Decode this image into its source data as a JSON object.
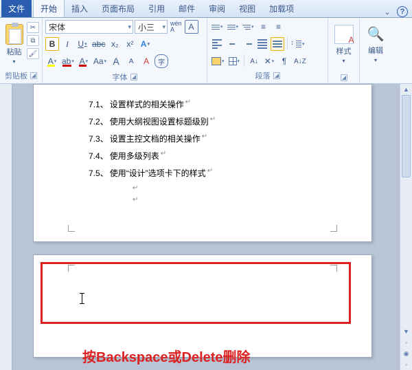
{
  "tabs": {
    "file": "文件",
    "items": [
      "开始",
      "插入",
      "页面布局",
      "引用",
      "邮件",
      "审阅",
      "视图",
      "加载项"
    ],
    "active": 0
  },
  "ribbon": {
    "clipboard": {
      "paste": "粘贴",
      "label": "剪贴板"
    },
    "font": {
      "name": "宋体",
      "size": "小三",
      "wen": "wén",
      "bold": "B",
      "italic": "I",
      "underline": "U",
      "strike": "abc",
      "sub": "x₂",
      "sup": "x²",
      "grow": "A",
      "shrink": "A",
      "case": "Aa",
      "clear": "A",
      "charborder": "A",
      "highlight": "A",
      "color": "A",
      "circled": "字",
      "label": "字体"
    },
    "paragraph": {
      "label": "段落"
    },
    "styles": {
      "btn": "样式",
      "label": ""
    },
    "editing": {
      "btn": "编辑",
      "label": ""
    }
  },
  "document": {
    "lines": [
      {
        "n": "7.1、",
        "t": "设置样式的相关操作"
      },
      {
        "n": "7.2、",
        "t": "使用大纲视图设置标题级别"
      },
      {
        "n": "7.3、",
        "t": "设置主控文档的相关操作"
      },
      {
        "n": "7.4、",
        "t": "使用多级列表"
      },
      {
        "n": "7.5、",
        "t": "使用“设计”选项卡下的样式"
      }
    ]
  },
  "annotation": "按Backspace或Delete删除"
}
